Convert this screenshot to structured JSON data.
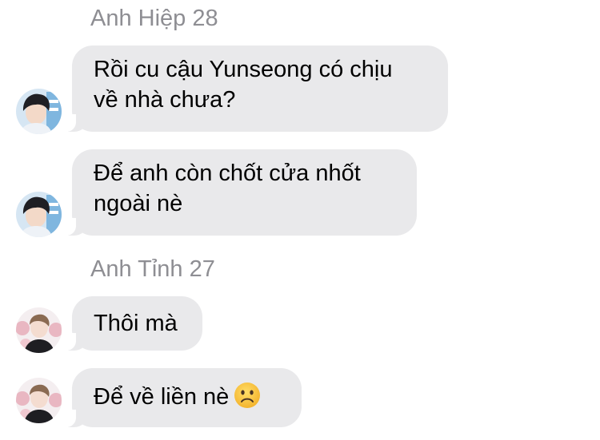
{
  "conversation": [
    {
      "sender": "Anh Hiệp 28",
      "messages": [
        {
          "lines": [
            "Rồi cu cậu Yunseong có chịu",
            "về nhà chưa?"
          ]
        },
        {
          "lines": [
            "Để anh còn chốt cửa nhốt",
            "ngoài nè"
          ]
        }
      ]
    },
    {
      "sender": "Anh Tỉnh 27",
      "messages": [
        {
          "lines": [
            "Thôi mà"
          ]
        },
        {
          "lines": [
            "Để về liền nè"
          ],
          "emoji": "frowning-face-icon"
        }
      ]
    }
  ],
  "colors": {
    "bubble": "#e9e9eb",
    "sender_name": "#8e8e93",
    "text": "#000000"
  }
}
